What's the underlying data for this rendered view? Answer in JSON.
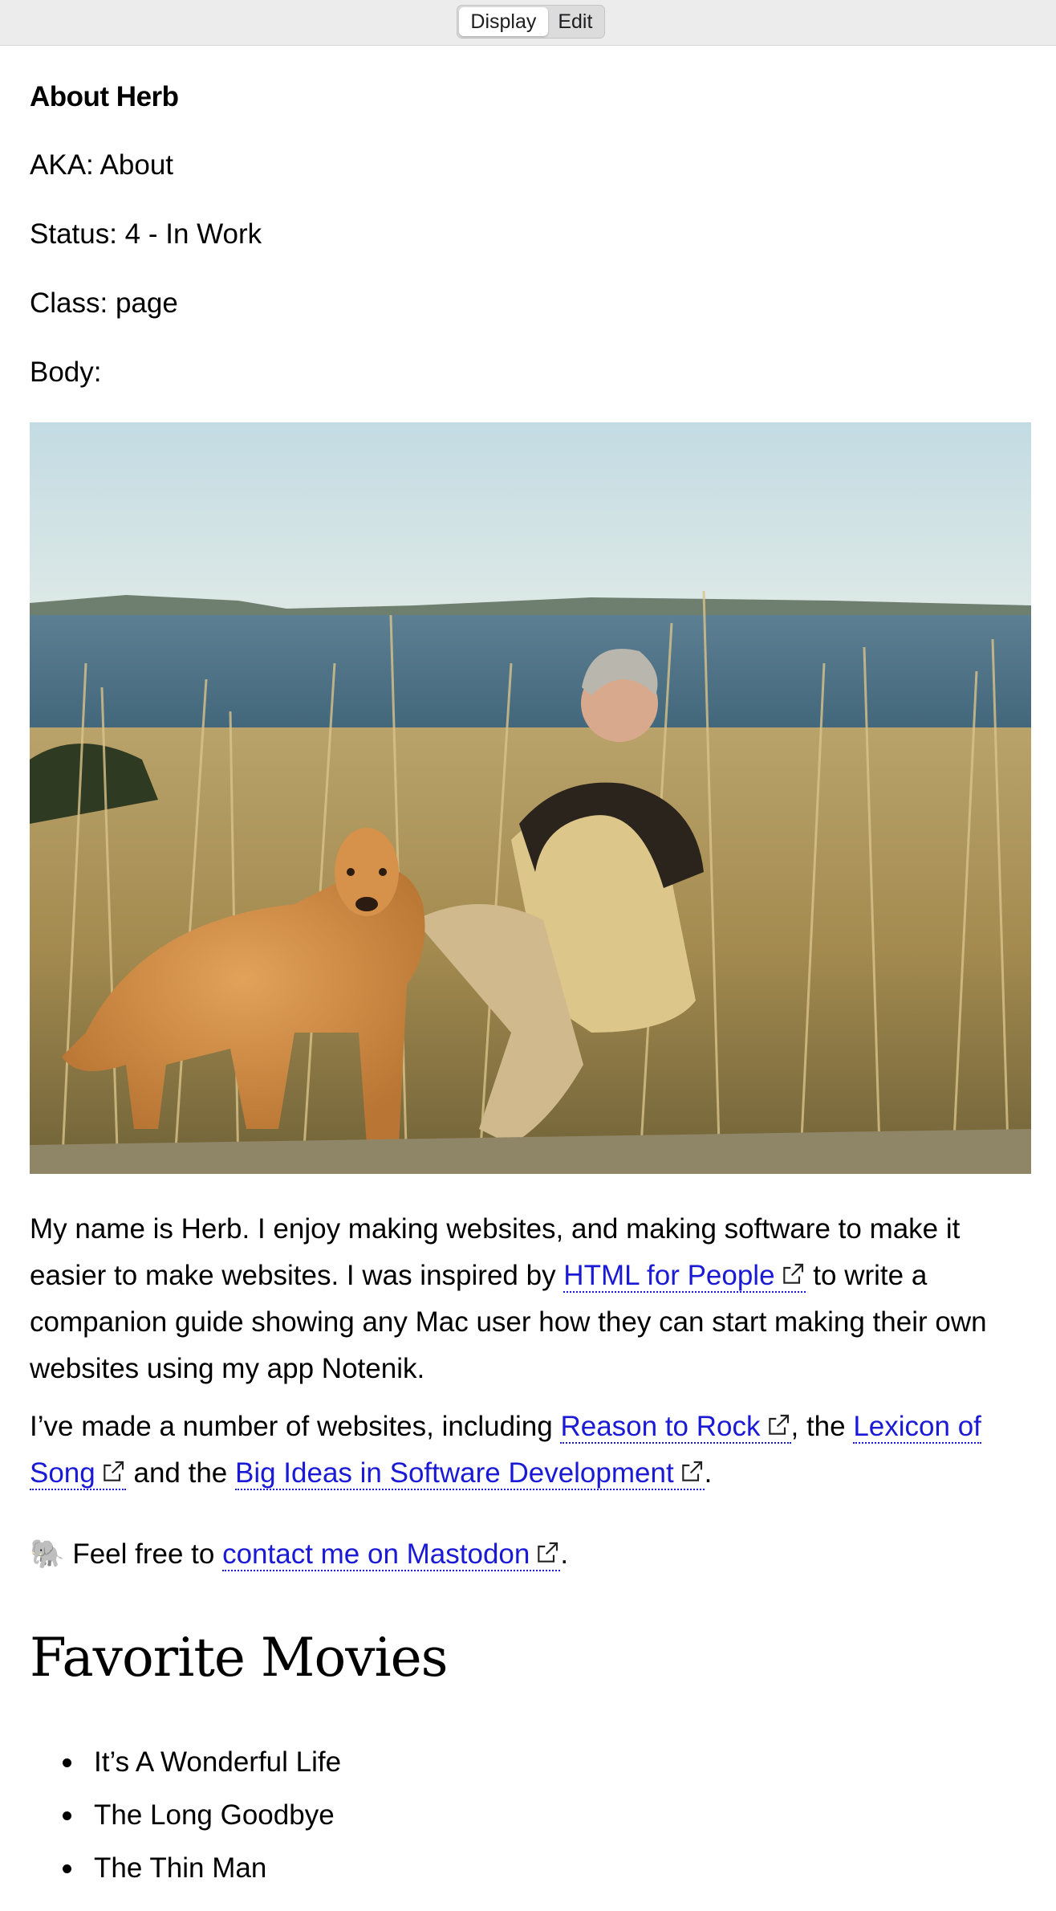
{
  "toolbar": {
    "display_label": "Display",
    "edit_label": "Edit"
  },
  "page": {
    "title": "About Herb",
    "aka": "AKA: About",
    "status": "Status: 4 - In Work",
    "class": "Class: page",
    "body_label": "Body:"
  },
  "body": {
    "p1_a": "My name is Herb. I enjoy making websites, and making software to make it easier to make websites. I was inspired by ",
    "p1_link": "HTML for People",
    "p1_b": " to write a companion guide showing any Mac user how they can start making their own websites using my app Notenik.",
    "p2_a": "I’ve made a number of websites, including ",
    "p2_link1": "Reason to Rock",
    "p2_b": ", the ",
    "p2_link2": "Lexicon of Song",
    "p2_c": " and the ",
    "p2_link3": "Big Ideas in Software Development",
    "p2_d": ".",
    "p3_emoji": "🐘",
    "p3_a": " Feel free to ",
    "p3_link": "contact me on Mastodon",
    "p3_b": "."
  },
  "movies": {
    "heading": "Favorite Movies",
    "items": [
      "It’s A Wonderful Life",
      "The Long Goodbye",
      "The Thin Man"
    ]
  },
  "colors": {
    "link": "#1a1ad6",
    "toolbar_bg": "#ececec"
  },
  "icons": [
    "external-link-icon",
    "elephant-emoji"
  ]
}
